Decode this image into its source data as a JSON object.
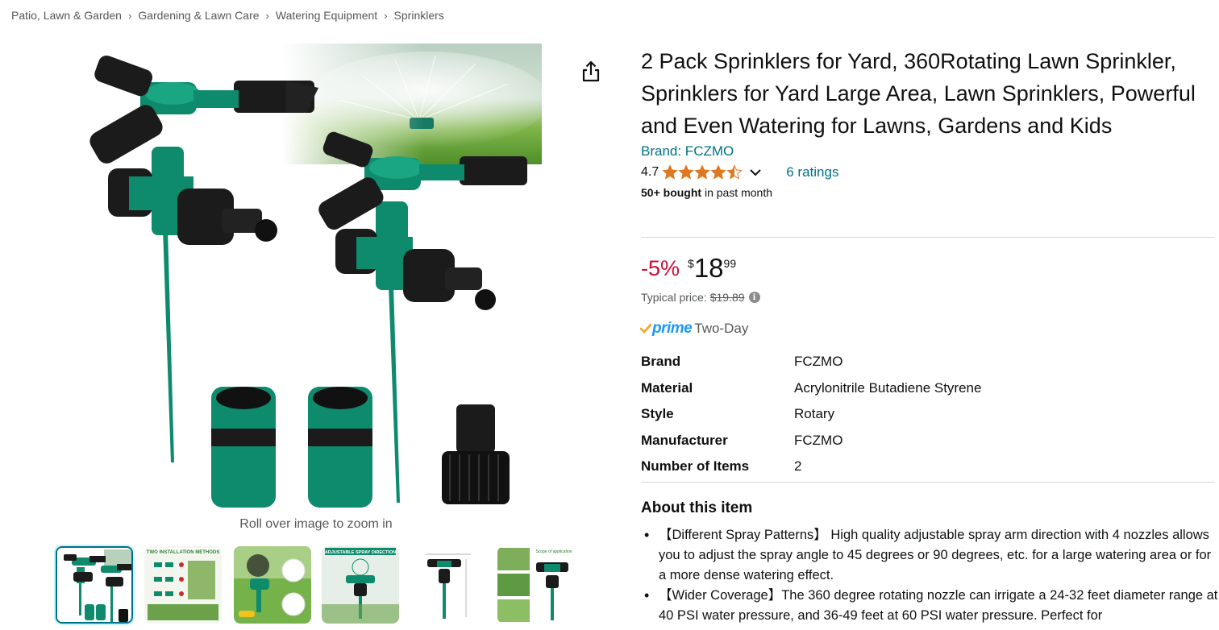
{
  "breadcrumb": {
    "items": [
      "Patio, Lawn & Garden",
      "Gardening & Lawn Care",
      "Watering Equipment",
      "Sprinklers"
    ],
    "separator": "›"
  },
  "gallery": {
    "zoom_hint": "Roll over image to zoom in",
    "thumbnail_count": 6,
    "active_thumbnail": 0,
    "thumbnail_captions": [
      "",
      "TWO INSTALLATION METHODS",
      "",
      "ADJUSTABLE SPRAY DIRECTION",
      "",
      "Scope of application"
    ]
  },
  "product": {
    "title": "2 Pack Sprinklers for Yard, 360Rotating Lawn Sprinkler, Sprinklers for Yard Large Area, Lawn Sprinklers, Powerful and Even Watering for Lawns, Gardens and Kids",
    "brand_link": "Brand: FCZMO",
    "rating_value": "4.7",
    "rating_stars": 4.5,
    "ratings_link": "6 ratings",
    "bought_strong": "50+ bought",
    "bought_rest": " in past month"
  },
  "price": {
    "discount": "-5%",
    "currency": "$",
    "whole": "18",
    "fraction": "99",
    "typical_label": "Typical price:",
    "typical_value": "$19.89",
    "info": "i"
  },
  "delivery": {
    "prime_label": "prime",
    "prime_speed": "Two-Day"
  },
  "specs": [
    {
      "key": "Brand",
      "value": "FCZMO"
    },
    {
      "key": "Material",
      "value": "Acrylonitrile Butadiene Styrene"
    },
    {
      "key": "Style",
      "value": "Rotary"
    },
    {
      "key": "Manufacturer",
      "value": "FCZMO"
    },
    {
      "key": "Number of Items",
      "value": "2"
    }
  ],
  "about": {
    "title": "About this item",
    "bullets": [
      "【Different Spray Patterns】 High quality adjustable spray arm direction with 4 nozzles allows you to adjust the spray angle to 45 degrees or 90 degrees, etc. for a large watering area or for a more dense watering effect.",
      "【Wider Coverage】The 360 degree rotating nozzle can irrigate a 24-32 feet diameter range at 40 PSI water pressure, and 36-49 feet at 60 PSI water pressure. Perfect for"
    ]
  },
  "colors": {
    "link": "#007185",
    "discount": "#cc0c39",
    "prime": "#1a98ff",
    "star": "#de7921",
    "sprinkler_green": "#0e8a6c",
    "divider": "#d5d9d9"
  },
  "icons": {
    "share": "share-icon",
    "chevron": "chevron-down-icon",
    "info": "info-icon",
    "prime_check": "prime-check-icon"
  }
}
